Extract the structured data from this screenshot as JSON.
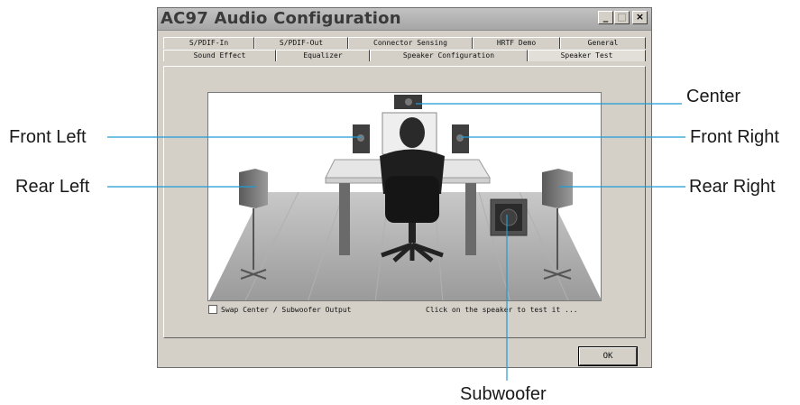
{
  "window": {
    "title": "AC97 Audio Configuration",
    "minimize_glyph": "_",
    "maximize_glyph": "□",
    "close_glyph": "×"
  },
  "tabs_row1": [
    "S/PDIF-In",
    "S/PDIF-Out",
    "Connector Sensing",
    "HRTF Demo",
    "General"
  ],
  "tabs_row2": [
    "Sound Effect",
    "Equalizer",
    "Speaker Configuration",
    "Speaker Test"
  ],
  "active_tab": "Speaker Test",
  "speaker_test": {
    "swap_label": "Swap Center / Subwoofer Output",
    "swap_checked": false,
    "hint": "Click on the speaker to test it ..."
  },
  "ok_label": "OK",
  "callouts": {
    "center": "Center",
    "front_left": "Front Left",
    "front_right": "Front Right",
    "rear_left": "Rear Left",
    "rear_right": "Rear Right",
    "subwoofer": "Subwoofer"
  },
  "colors": {
    "callout_line": "#1e9bd7",
    "window_face": "#d4d0c8",
    "titlebar": "#b0b0b0"
  }
}
